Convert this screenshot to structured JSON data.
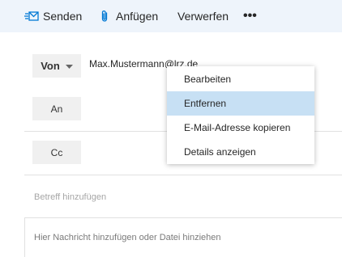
{
  "toolbar": {
    "send_label": "Senden",
    "send_icon": "send-icon",
    "attach_label": "Anfügen",
    "attach_icon": "paperclip-icon",
    "discard_label": "Verwerfen",
    "more_label": "•••",
    "background": "#eef4fb",
    "accent": "#0078d4"
  },
  "compose": {
    "from_label": "Von",
    "from_address": "Max.Mustermann@lrz.de",
    "to_label": "An",
    "cc_label": "Cc",
    "subject_placeholder": "Betreff hinzufügen",
    "body_placeholder": "Hier Nachricht hinzufügen oder Datei hinziehen"
  },
  "context_menu": {
    "items": [
      {
        "label": "Bearbeiten"
      },
      {
        "label": "Entfernen",
        "highlighted": true
      },
      {
        "label": "E-Mail-Adresse kopieren"
      },
      {
        "label": "Details anzeigen"
      }
    ],
    "highlight_color": "#c7e0f4"
  }
}
